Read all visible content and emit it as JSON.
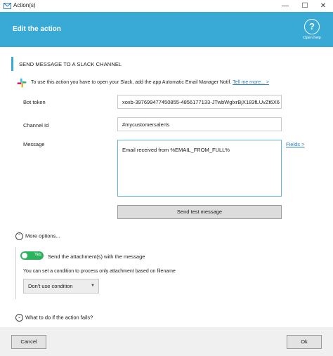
{
  "window": {
    "title": "Action(s)",
    "minimize_icon": "minimize-icon",
    "maximize_icon": "maximize-icon",
    "close_icon": "close-icon"
  },
  "header": {
    "title": "Edit the action",
    "help_label": "Open help",
    "accent": "#39aad6"
  },
  "section": {
    "title": "SEND MESSAGE TO A SLACK CHANNEL"
  },
  "info": {
    "text": "To use this action you have to open your Slack, add the app Automatic Email Manager Notif.",
    "link": "Tell me more... >",
    "icon": "slack-icon"
  },
  "form": {
    "bot_token_label": "Bot token",
    "bot_token_value": "xoxb-397699477450855-4856177133-JTwbWglxrBjX183fLUvZt6X6",
    "channel_label": "Channel Id",
    "channel_value": "#mycustomersalerts",
    "message_label": "Message",
    "message_value": "Email received from %EMAIL_FROM_FULL%",
    "fields_link": "Fields >",
    "test_button": "Send test message"
  },
  "more_options": {
    "label": "More options...",
    "toggle_text": "Yes",
    "toggle_on": true,
    "toggle_label": "Send the attachment(s) with the message",
    "condition_label": "You can set a condition to process only attachment based on filename",
    "condition_value": "Don't use condition",
    "toggle_color": "#2cb35d"
  },
  "fail_section": {
    "label": "What to do if the action fails?"
  },
  "footer": {
    "cancel": "Cancel",
    "ok": "Ok"
  }
}
